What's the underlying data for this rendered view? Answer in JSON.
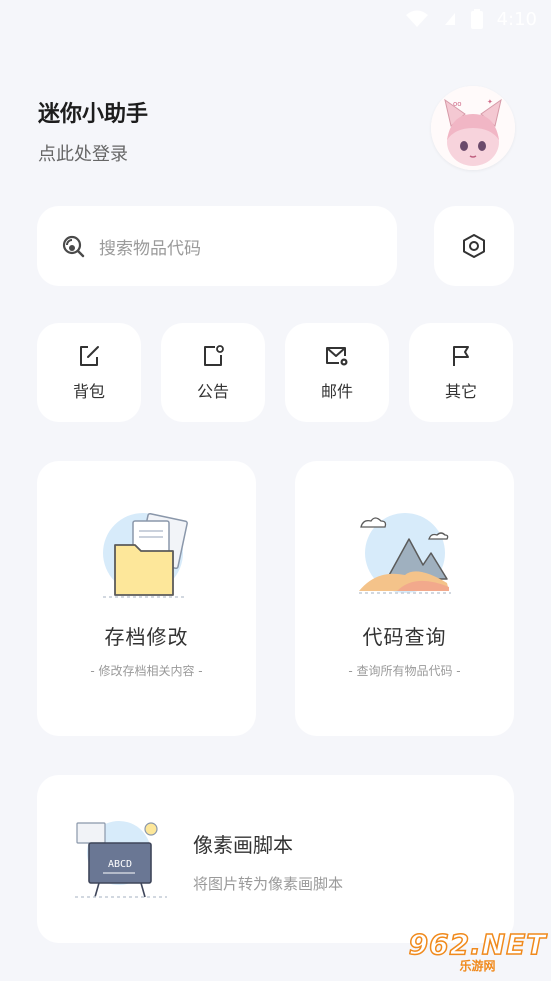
{
  "status_bar": {
    "time": "4:10"
  },
  "header": {
    "title": "迷你小助手",
    "login_prompt": "点此处登录"
  },
  "search": {
    "placeholder": "搜索物品代码"
  },
  "quick_actions": [
    {
      "label": "背包",
      "icon": "edit-icon"
    },
    {
      "label": "公告",
      "icon": "notice-icon"
    },
    {
      "label": "邮件",
      "icon": "mail-settings-icon"
    },
    {
      "label": "其它",
      "icon": "flag-icon"
    }
  ],
  "features": [
    {
      "title": "存档修改",
      "subtitle": "- 修改存档相关内容 -",
      "icon": "folder-illustration"
    },
    {
      "title": "代码查询",
      "subtitle": "- 查询所有物品代码 -",
      "icon": "mountain-illustration"
    }
  ],
  "pixel_script": {
    "title": "像素画脚本",
    "subtitle": "将图片转为像素画脚本",
    "board_text": "ABCD",
    "icon": "blackboard-illustration"
  },
  "watermark": {
    "main": "962.NET",
    "sub": "乐游网"
  },
  "colors": {
    "background": "#f5f6fa",
    "card": "#ffffff",
    "accent_orange": "#f08a1d"
  }
}
